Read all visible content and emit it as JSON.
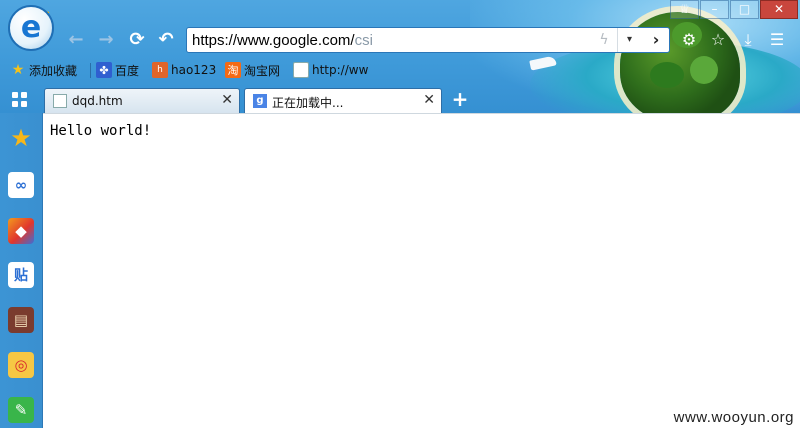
{
  "browser": {
    "logo_letter": "e",
    "colors": {
      "chrome_blue": "#3f9ad9",
      "close_red": "#c9463d",
      "accent": "#1976d2"
    }
  },
  "toolbar": {
    "back_icon": "←",
    "forward_icon": "→",
    "refresh_icon": "⟳",
    "undo_icon": "↶",
    "address": {
      "main": "https://www.google.com/",
      "selected": "csi"
    },
    "bolt_icon": "ϟ",
    "dropdown_icon": "▾",
    "go_icon": "›",
    "right_icons": {
      "gear": "⚙",
      "star": "☆",
      "download": "⤓",
      "menu": "☰"
    }
  },
  "window_controls": {
    "skin": "♕",
    "minimize": "–",
    "maximize": "□",
    "close": "✕"
  },
  "bookmarks": [
    {
      "label": "添加收藏",
      "icon": "star-add-icon"
    },
    {
      "label": "百度",
      "icon": "baidu-paw-icon"
    },
    {
      "label": "hao123",
      "icon": "hao123-icon"
    },
    {
      "label": "淘宝网",
      "icon": "taobao-icon"
    },
    {
      "label": "http://ww",
      "icon": "page-icon"
    }
  ],
  "tabs": [
    {
      "title": "dqd.htm",
      "close": "✕"
    },
    {
      "title": "正在加载中...",
      "close": "✕"
    }
  ],
  "new_tab": "+",
  "sidebar": [
    {
      "name": "favorites",
      "glyph": "★"
    },
    {
      "name": "baidu-cloud",
      "glyph": "∞"
    },
    {
      "name": "app-store",
      "glyph": "◆"
    },
    {
      "name": "tieba",
      "glyph": "贴"
    },
    {
      "name": "reader",
      "glyph": "▤"
    },
    {
      "name": "weibo",
      "glyph": "◎"
    },
    {
      "name": "notes",
      "glyph": "✎"
    }
  ],
  "page": {
    "text": "Hello world!"
  },
  "watermark": "www.wooyun.org"
}
